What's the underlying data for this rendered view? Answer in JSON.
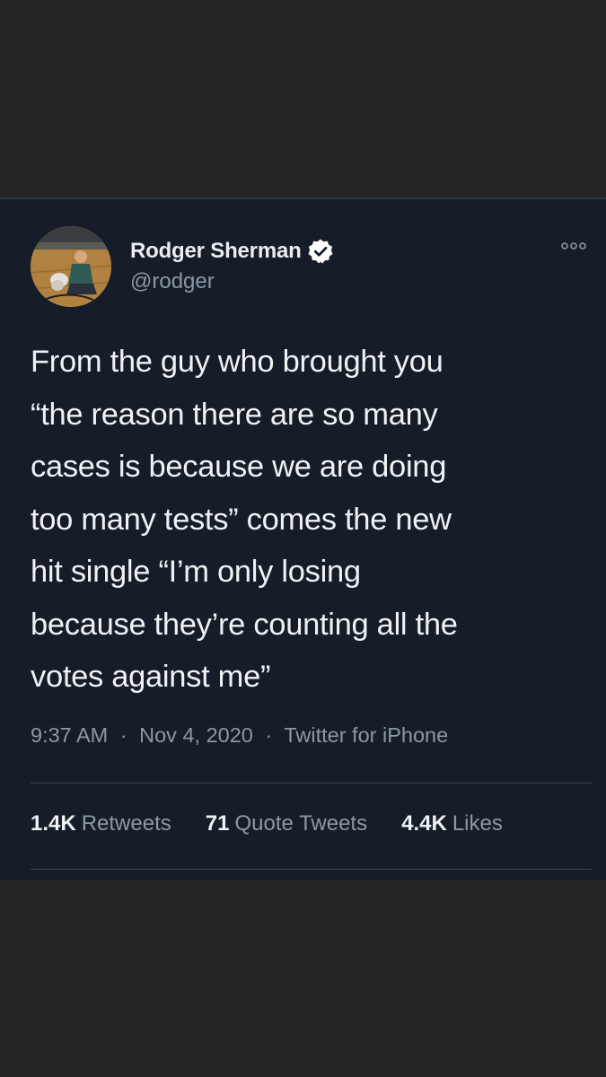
{
  "tweet": {
    "author": {
      "display_name": "Rodger Sherman",
      "handle": "@rodger",
      "verified": true
    },
    "text_lines": [
      "From the guy who brought you",
      "“the reason there are so many",
      "cases is because we are doing",
      "too many tests” comes the new",
      "hit single “I’m only losing",
      "because they’re counting all the",
      "votes against me”"
    ],
    "time": "9:37 AM",
    "date": "Nov 4, 2020",
    "source": "Twitter for iPhone",
    "separator": "·",
    "stats": {
      "retweets": {
        "count": "1.4K",
        "label": "Retweets"
      },
      "quote_tweets": {
        "count": "71",
        "label": "Quote Tweets"
      },
      "likes": {
        "count": "4.4K",
        "label": "Likes"
      }
    }
  },
  "icons": {
    "more": "more-options-icon",
    "verified": "verified-badge-icon"
  },
  "colors": {
    "page_background": "#242424",
    "card_background": "#161d29",
    "primary_text": "#eef2f5",
    "secondary_text": "#8b98a5",
    "divider": "#38444d"
  }
}
